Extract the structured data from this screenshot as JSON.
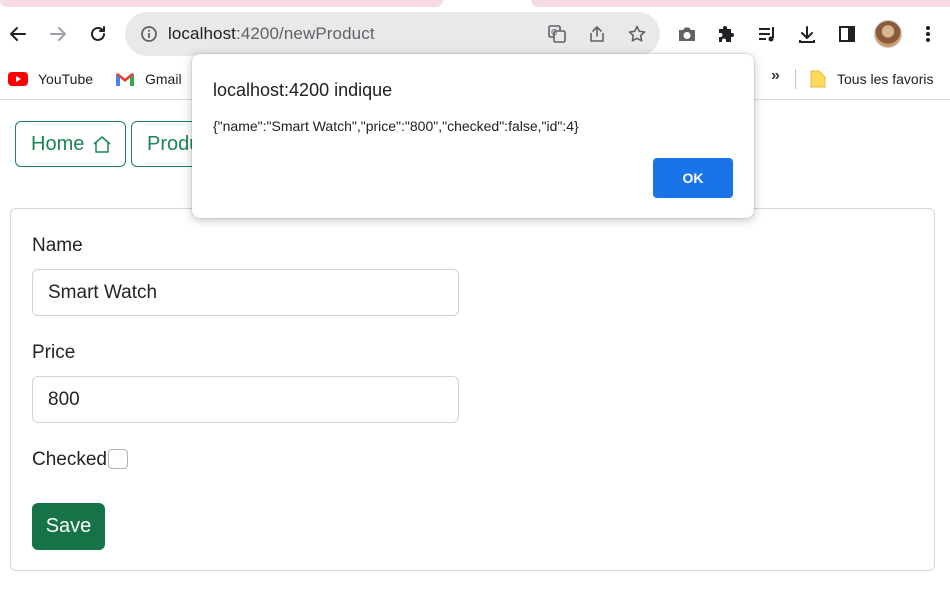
{
  "browser": {
    "url_host": "localhost",
    "url_path": ":4200/newProduct",
    "bookmarks": [
      {
        "label": "YouTube",
        "icon": "youtube-icon"
      },
      {
        "label": "Gmail",
        "icon": "gmail-icon"
      }
    ],
    "overflow_label": "»",
    "all_bookmarks_label": "Tous les favoris"
  },
  "nav": {
    "home_label": "Home",
    "products_label": "Produ"
  },
  "form": {
    "name_label": "Name",
    "name_value": "Smart Watch",
    "price_label": "Price",
    "price_value": "800",
    "checked_label": "Checked",
    "checked": false,
    "save_label": "Save"
  },
  "dialog": {
    "title": "localhost:4200 indique",
    "message": "{\"name\":\"Smart Watch\",\"price\":\"800\",\"checked\":false,\"id\":4}",
    "ok_label": "OK"
  },
  "colors": {
    "accent_green": "#198754",
    "save_green": "#157347",
    "dialog_blue": "#1a73e8"
  }
}
